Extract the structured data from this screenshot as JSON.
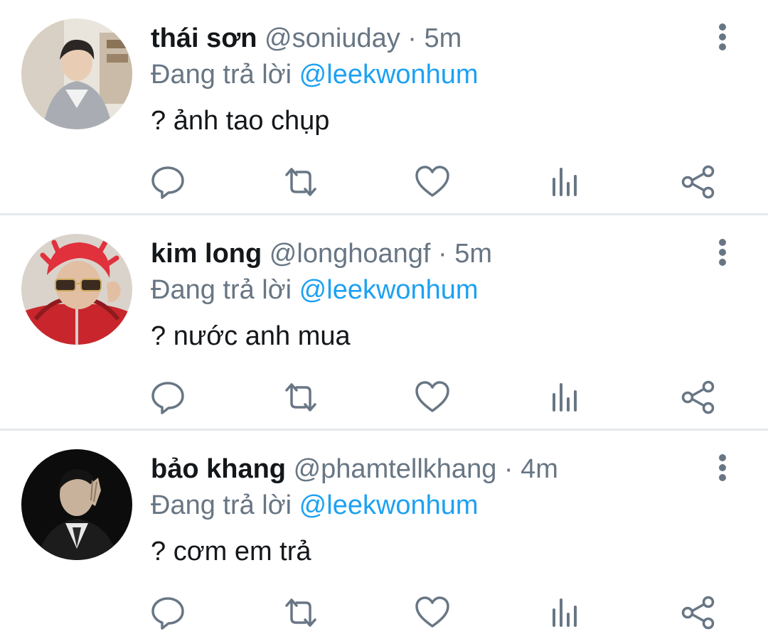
{
  "colors": {
    "text_primary": "#14171a",
    "text_secondary": "#687684",
    "link": "#1da1f2",
    "divider": "#e6e9ec",
    "icon": "#687684"
  },
  "icons": {
    "reply": "reply-icon",
    "retweet": "retweet-icon",
    "like": "heart-icon",
    "stats": "analytics-icon",
    "share": "share-icon",
    "more": "more-vertical-icon"
  },
  "tweets": [
    {
      "display_name": "thái sơn",
      "handle": "@soniuday",
      "separator": "·",
      "time": "5m",
      "reply_prefix": "Đang trả lời",
      "reply_to": "@leekwonhum",
      "text": "? ảnh tao chụp"
    },
    {
      "display_name": "kim long",
      "handle": "@longhoangf",
      "separator": "·",
      "time": "5m",
      "reply_prefix": "Đang trả lời",
      "reply_to": "@leekwonhum",
      "text": "? nước anh mua"
    },
    {
      "display_name": "bảo khang",
      "handle": "@phamtellkhang",
      "separator": "·",
      "time": "4m",
      "reply_prefix": "Đang trả lời",
      "reply_to": "@leekwonhum",
      "text": "? cơm em trả"
    }
  ]
}
